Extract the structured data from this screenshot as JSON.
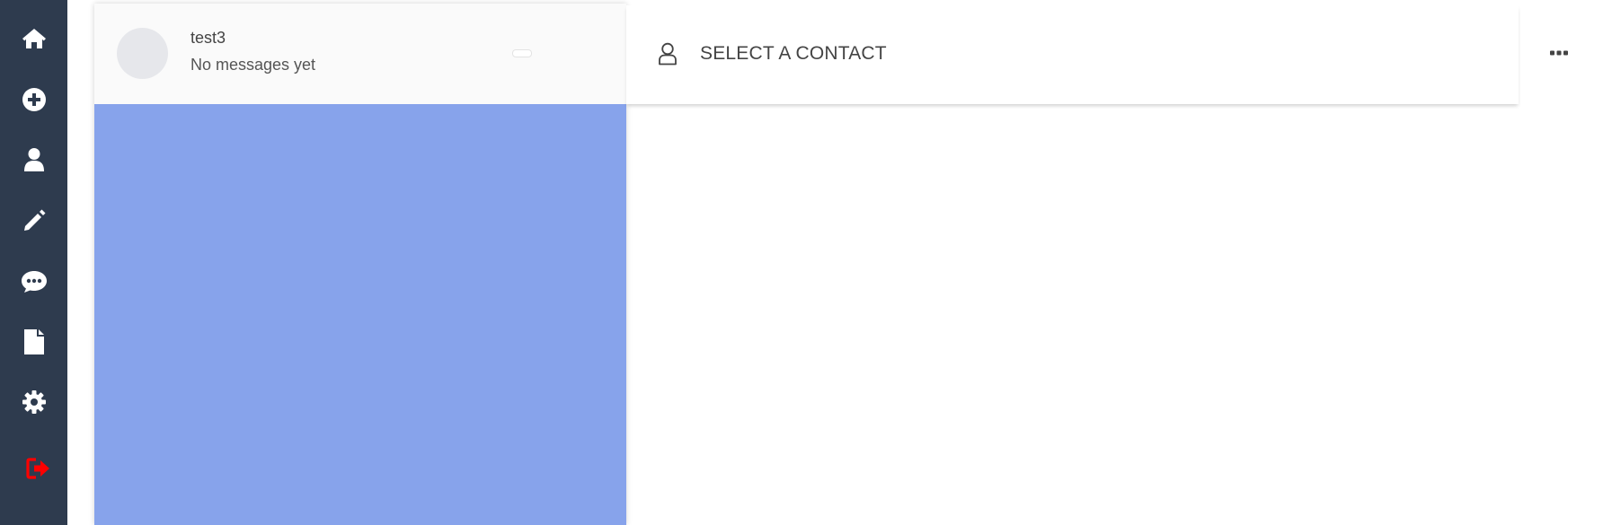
{
  "sidebar": {
    "items": [
      {
        "icon": "home-icon"
      },
      {
        "icon": "plus-circle-icon"
      },
      {
        "icon": "user-icon"
      },
      {
        "icon": "pencil-icon"
      },
      {
        "icon": "chat-bubble-icon"
      },
      {
        "icon": "file-icon"
      },
      {
        "icon": "gear-icon"
      },
      {
        "icon": "sign-out-icon",
        "color": "#ff0000"
      }
    ],
    "background": "#2e3b4e"
  },
  "contacts": {
    "panel_color": "#87a3eb",
    "items": [
      {
        "name": "test3",
        "preview": "No messages yet"
      }
    ]
  },
  "chat": {
    "title": "SELECT A CONTACT",
    "header_icon": "user-outline-icon"
  },
  "toolbar": {
    "more_icon": "ellipsis-icon"
  }
}
